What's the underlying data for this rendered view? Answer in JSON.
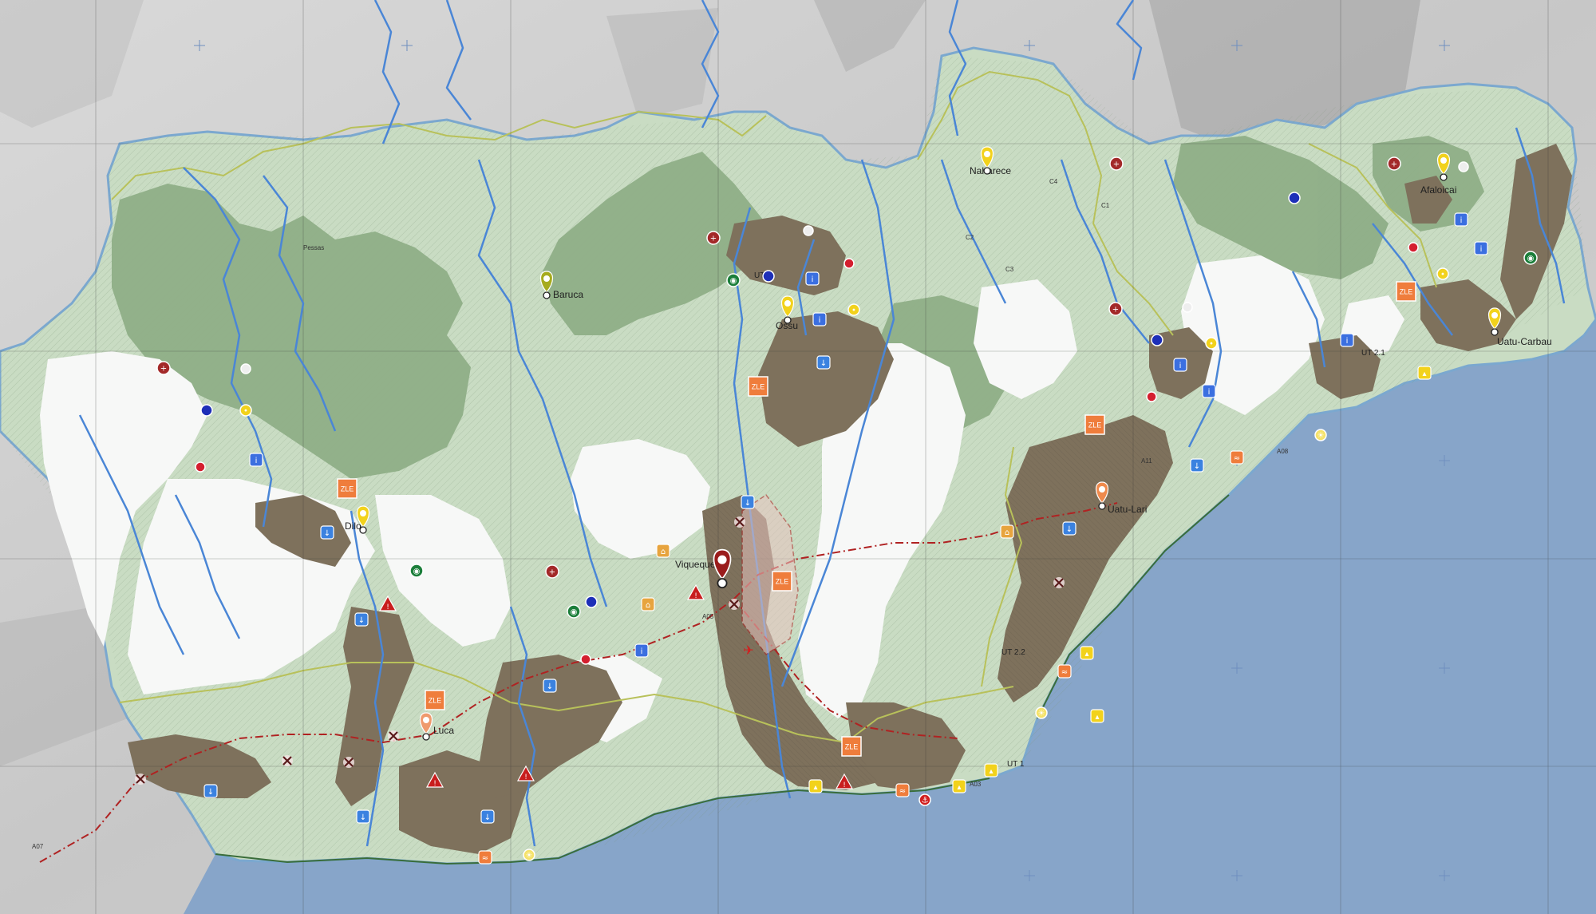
{
  "places": [
    {
      "name": "Naharece"
    },
    {
      "name": "Baruca"
    },
    {
      "name": "Ossu"
    },
    {
      "name": "Afaloicai"
    },
    {
      "name": "Uatu-Carbau"
    },
    {
      "name": "Uatu-Lari"
    },
    {
      "name": "Viqueque"
    },
    {
      "name": "Dilor"
    },
    {
      "name": "Luca"
    },
    {
      "name": "Pessas"
    }
  ],
  "zone_label": "ZLE",
  "unit_labels": [
    "UT 2.2",
    "UT 1",
    "UT 2.1",
    "UT 3"
  ],
  "road_labels": [
    "A07",
    "A05",
    "A11",
    "A03",
    "A08",
    "C1",
    "C2",
    "C3",
    "C4"
  ],
  "colors": {
    "sea": "#87a5c9",
    "land": "#cfcfcf",
    "pale_green": "#c9dcc3",
    "forest": "#8fae87",
    "brown": "#7e715c",
    "white_area": "#f7f8f7",
    "rivers": "#4a86d6",
    "border_yellow": "#b8c15a",
    "road_red": "#b02222",
    "zle_orange": "#ef7d3c",
    "pin_yellow": "#f2d21c",
    "pin_olive": "#a6ab1e"
  },
  "icons": [
    "zle-icon",
    "red-cross-icon",
    "camera-icon",
    "info-icon",
    "water-tap-icon",
    "warning-icon",
    "church-icon",
    "airport-icon",
    "crossing-icon",
    "turtle-icon",
    "sun-icon",
    "anchor-icon"
  ]
}
